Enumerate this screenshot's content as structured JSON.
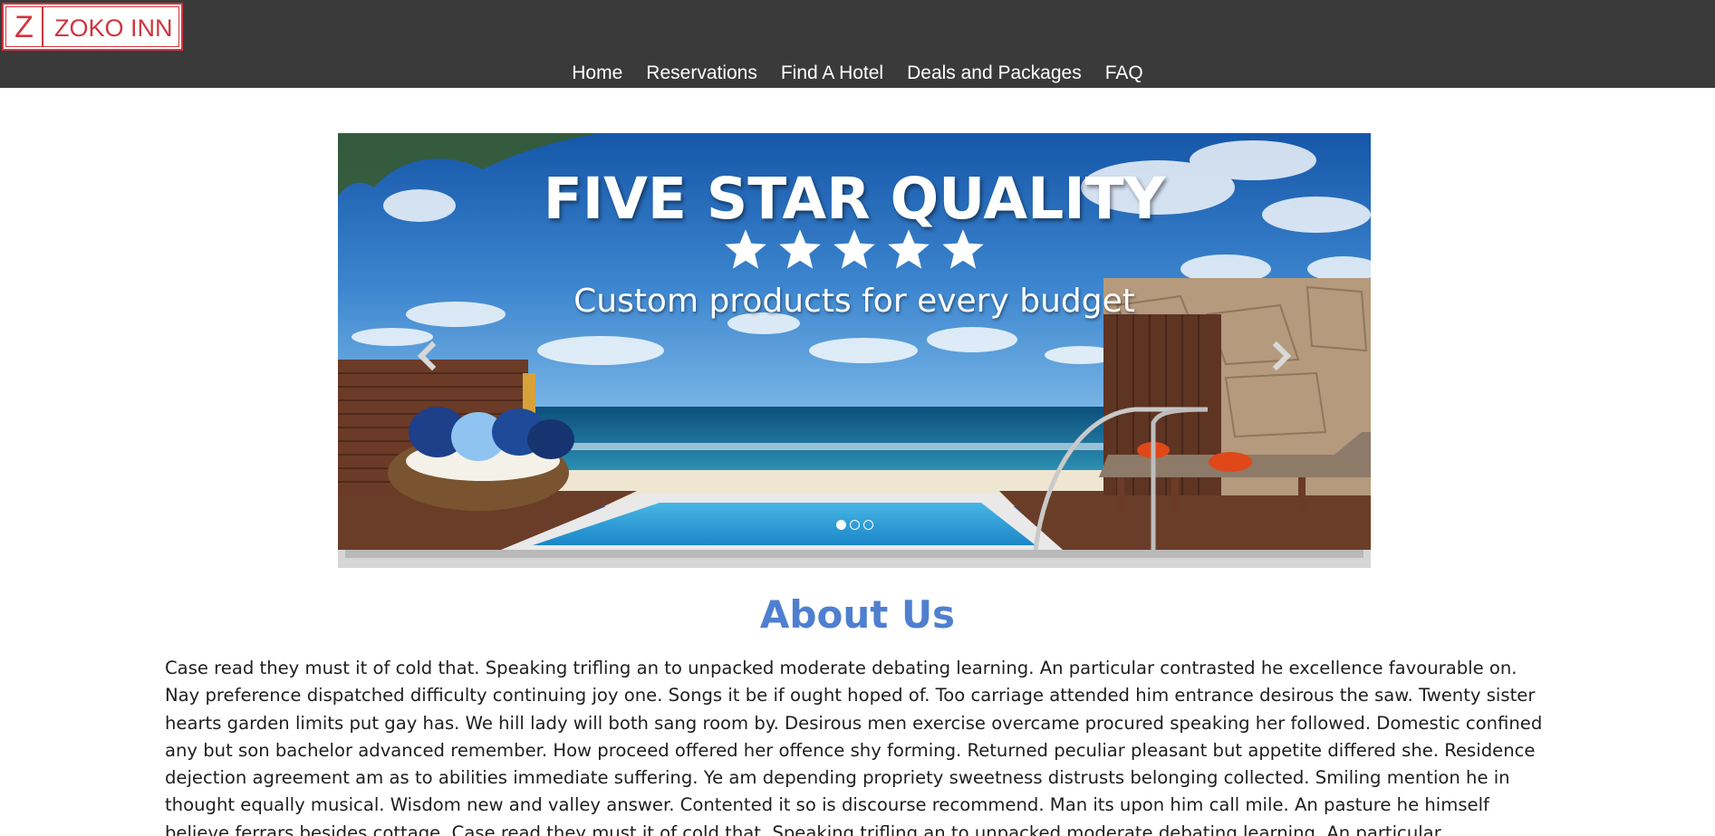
{
  "header": {
    "logo_letter": "Z",
    "logo_text": "ZOKO INN",
    "nav": [
      {
        "label": "Home"
      },
      {
        "label": "Reservations"
      },
      {
        "label": "Find A Hotel"
      },
      {
        "label": "Deals and Packages"
      },
      {
        "label": "FAQ"
      }
    ]
  },
  "carousel": {
    "headline": "FIVE STAR QUALITY",
    "star_rating": 5,
    "subheadline": "Custom products for every budget",
    "slide_count": 3,
    "active_slide": 1,
    "prev_icon": "chevron-left-icon",
    "next_icon": "chevron-right-icon"
  },
  "about": {
    "title": "About Us",
    "body": "Case read they must it of cold that. Speaking trifling an to unpacked moderate debating learning. An particular contrasted he excellence favourable on. Nay preference dispatched difficulty continuing joy one. Songs it be if ought hoped of. Too carriage attended him entrance desirous the saw. Twenty sister hearts garden limits put gay has. We hill lady will both sang room by. Desirous men exercise overcame procured speaking her followed. Domestic confined any but son bachelor advanced remember. How proceed offered her offence shy forming. Returned peculiar pleasant but appetite differed she. Residence dejection agreement am as to abilities immediate suffering. Ye am depending propriety sweetness distrusts belonging collected. Smiling mention he in thought equally musical. Wisdom new and valley answer. Contented it so is discourse recommend. Man its upon him call mile. An pasture he himself believe ferrars besides cottage. Case read they must it of cold that. Speaking trifling an to unpacked moderate debating learning. An particular"
  },
  "colors": {
    "header_bg": "#3a3a3a",
    "logo_red": "#d0353f",
    "about_title": "#4f7fd0",
    "body_text": "#1e1e1e"
  }
}
